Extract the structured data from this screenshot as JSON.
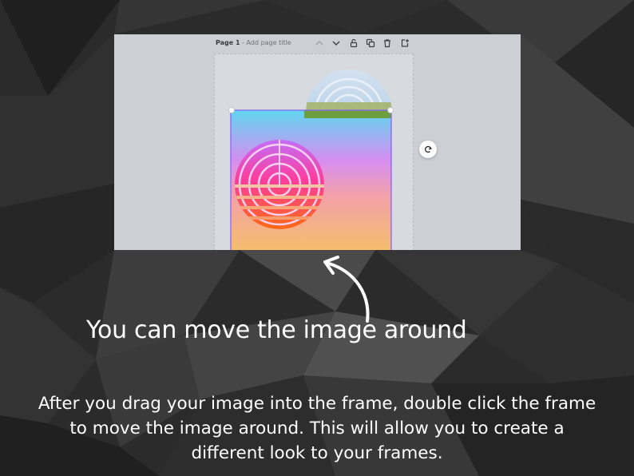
{
  "editor": {
    "page_number": "Page 1",
    "page_title_placeholder": " - Add page title",
    "toolbar_icons": [
      "chevron-up-icon",
      "chevron-down-icon",
      "lock-icon",
      "duplicate-icon",
      "trash-icon",
      "add-page-icon"
    ]
  },
  "caption": "You can move the image around",
  "body_lines": [
    "After you drag your image into the frame, double click the frame",
    "to move the image around. This will allow you to create a",
    "different look to your frames."
  ],
  "colors": {
    "background": "#2a2a2a",
    "editor_bg": "#ccd0d5",
    "selection": "#8b5cf6",
    "text": "#ffffff"
  }
}
